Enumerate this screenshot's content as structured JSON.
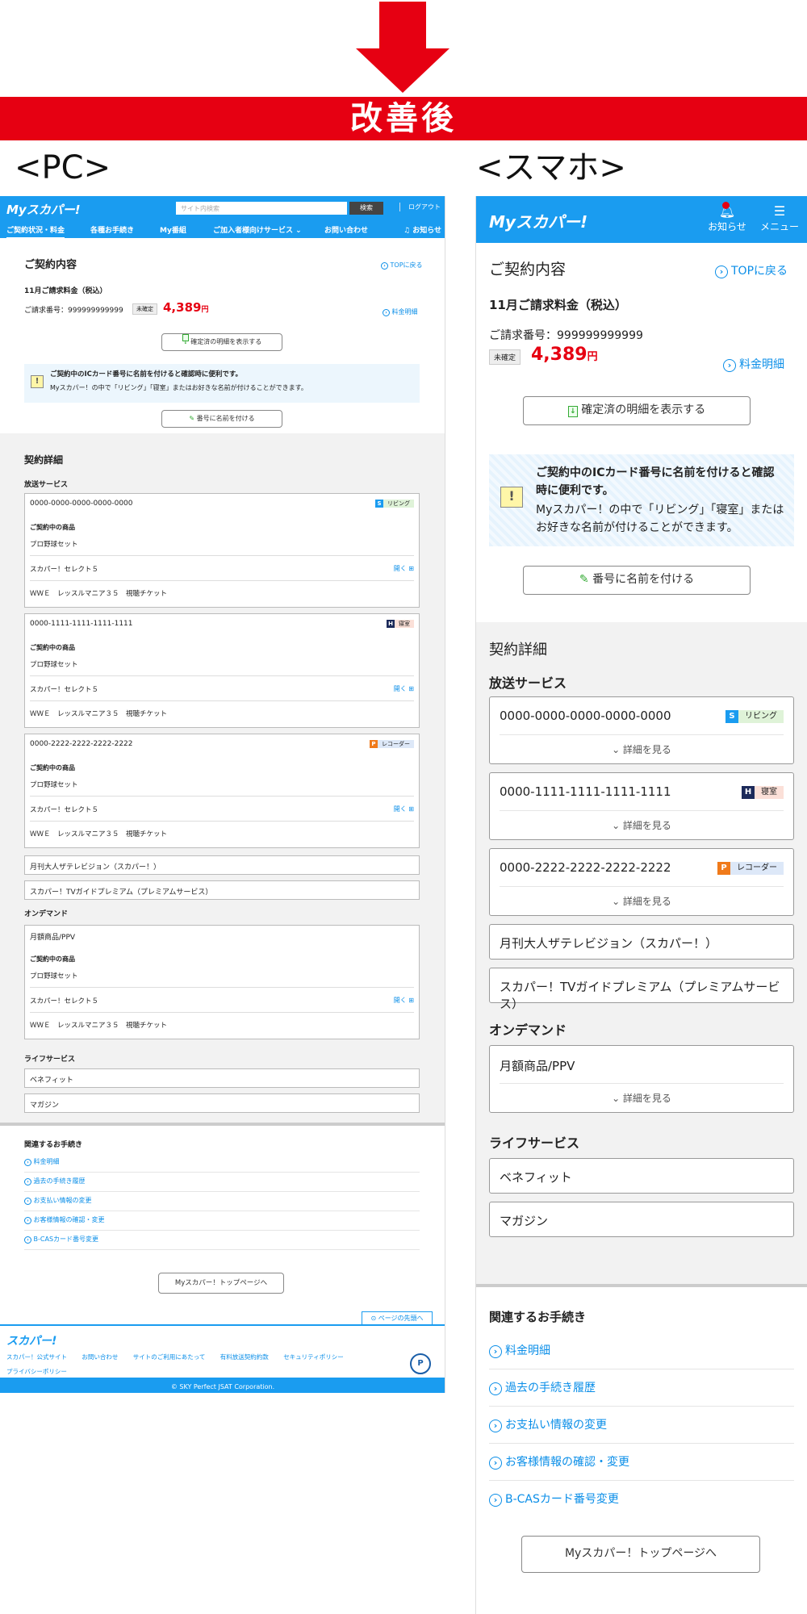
{
  "banner": {
    "label": "改善後"
  },
  "sections": {
    "pc": "<PC>",
    "sp": "<スマホ>"
  },
  "pc": {
    "logo": "Myスカパー!",
    "search_placeholder": "サイト内検索",
    "search_button": "検索",
    "logout": "ログアウト",
    "nav": [
      "ご契約状況・料金",
      "各種お手続き",
      "My番組",
      "ご加入者様向けサービス ⌄",
      "お問い合わせ",
      "♫ お知らせ"
    ],
    "contract_title": "ご契約内容",
    "top_link": "TOPに戻る",
    "bill_title": "11月ご請求料金（税込）",
    "bill_number": "ご請求番号：999999999999",
    "status_tag": "未確定",
    "amount": "4,389",
    "amount_unit": "円",
    "statement_link": "料金明細",
    "confirmed_button": "確定済の明細を表示する",
    "notice_bold": "ご契約中のICカード番号に名前を付けると確認時に便利です。",
    "notice_text": "Myスカパー！の中で「リビング」「寝室」またはお好きな名前が付けることができます。",
    "name_button": "番号に名前を付ける",
    "detail_title": "契約詳細",
    "broadcast_title": "放送サービス",
    "cards": [
      {
        "number": "0000-0000-0000-0000-0000",
        "chip_icon": "S",
        "chip_label": "リビング",
        "chip_color": "#1a9cf0",
        "chip_bg": "#dff3d8",
        "current_label": "ご契約中の商品",
        "product": "プロ野球セット",
        "service": "スカパー！セレクト５",
        "open": "開く",
        "ticket": "ＷＷＥ　レッスルマニア３５　視聴チケット"
      },
      {
        "number": "0000-1111-1111-1111-1111",
        "chip_icon": "H",
        "chip_label": "寝室",
        "chip_color": "#1c2a5a",
        "chip_bg": "#fbe0d8",
        "current_label": "ご契約中の商品",
        "product": "プロ野球セット",
        "service": "スカパー！セレクト５",
        "open": "開く",
        "ticket": "ＷＷＥ　レッスルマニア３５　視聴チケット"
      },
      {
        "number": "0000-2222-2222-2222-2222",
        "chip_icon": "P",
        "chip_label": "レコーダー",
        "chip_color": "#f07a1a",
        "chip_bg": "#dde8f8",
        "current_label": "ご契約中の商品",
        "product": "プロ野球セット",
        "service": "スカパー！セレクト５",
        "open": "開く",
        "ticket": "ＷＷＥ　レッスルマニア３５　視聴チケット"
      }
    ],
    "simple_items": [
      "月刊大人ザテレビジョン（スカパー！）",
      "スカパー！TVガイドプレミアム（プレミアムサービス）"
    ],
    "ondemand_title": "オンデマンド",
    "ondemand_card": {
      "name": "月額商品/PPV",
      "current_label": "ご契約中の商品",
      "product": "プロ野球セット",
      "service": "スカパー！セレクト５",
      "open": "開く",
      "ticket": "ＷＷＥ　レッスルマニア３５　視聴チケット"
    },
    "life_title": "ライフサービス",
    "life_items": [
      "ベネフィット",
      "マガジン"
    ],
    "proc_title": "関連するお手続き",
    "proc_items": [
      "料金明細",
      "過去の手続き履歴",
      "お支払い情報の変更",
      "お客様情報の確認・変更",
      "B-CASカード番号変更"
    ],
    "top_button": "Myスカパー！トップページへ",
    "page_top": "ページの先頭へ",
    "footer_logo": "スカパー!",
    "footer_links": [
      "スカパー！公式サイト",
      "お問い合わせ",
      "サイトのご利用にあたって",
      "有料放送契約約款",
      "セキュリティポリシー",
      "プライバシーポリシー"
    ],
    "copyright": "© SKY Perfect JSAT Corporation."
  },
  "sp": {
    "logo": "Myスカパー!",
    "notify": "お知らせ",
    "menu": "メニュー",
    "contract_title": "ご契約内容",
    "top_link": "TOPに戻る",
    "bill_title": "11月ご請求料金（税込）",
    "bill_number": "ご請求番号：999999999999",
    "status_tag": "未確定",
    "amount": "4,389",
    "amount_unit": "円",
    "statement_link": "料金明細",
    "confirmed_button": "確定済の明細を表示する",
    "notice_bold": "ご契約中のICカード番号に名前を付けると確認時に便利です。",
    "notice_text": "Myスカパー！の中で「リビング」「寝室」またはお好きな名前が付けることができます。",
    "name_button": "番号に名前を付ける",
    "detail_title": "契約詳細",
    "broadcast_title": "放送サービス",
    "cards": [
      {
        "number": "0000-0000-0000-0000-0000",
        "chip_icon": "S",
        "chip_label": "リビング",
        "more": "⌄ 詳細を見る"
      },
      {
        "number": "0000-1111-1111-1111-1111",
        "chip_icon": "H",
        "chip_label": "寝室",
        "more": "⌄ 詳細を見る"
      },
      {
        "number": "0000-2222-2222-2222-2222",
        "chip_icon": "P",
        "chip_label": "レコーダー",
        "more": "⌄ 詳細を見る"
      }
    ],
    "simple_items": [
      "月刊大人ザテレビジョン（スカパー！）",
      "スカパー！TVガイドプレミアム（プレミアムサービス）"
    ],
    "ondemand_title": "オンデマンド",
    "ondemand_card": {
      "name": "月額商品/PPV",
      "more": "⌄ 詳細を見る"
    },
    "life_title": "ライフサービス",
    "life_items": [
      "ベネフィット",
      "マガジン"
    ],
    "proc_title": "関連するお手続き",
    "proc_items": [
      "料金明細",
      "過去の手続き履歴",
      "お支払い情報の変更",
      "お客様情報の確認・変更",
      "B-CASカード番号変更"
    ],
    "top_button": "Myスカパー！トップページへ"
  }
}
